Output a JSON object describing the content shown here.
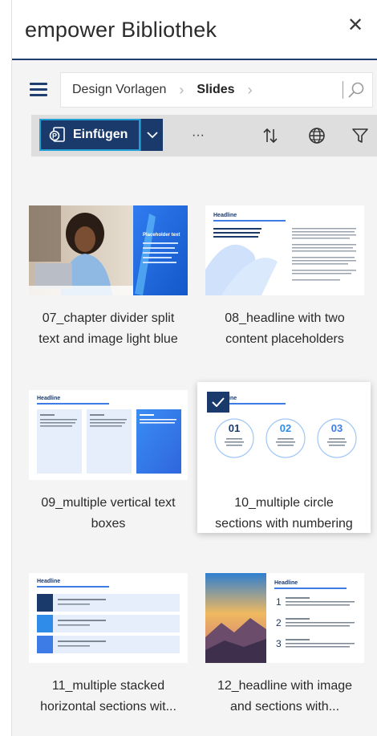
{
  "panel": {
    "title": "empower Bibliothek",
    "close_label": "✕"
  },
  "breadcrumb": {
    "items": [
      "Design Vorlagen",
      "Slides"
    ]
  },
  "toolbar": {
    "insert_label": "Einfügen",
    "more_label": "···"
  },
  "slides": [
    {
      "line1": "07_chapter divider split",
      "line2": "text and image light blue",
      "selected": false
    },
    {
      "line1": "08_headline with two",
      "line2": "content placeholders",
      "selected": false
    },
    {
      "line1": "09_multiple vertical text",
      "line2": "boxes",
      "selected": false
    },
    {
      "line1": "10_multiple circle",
      "line2": "sections with numbering",
      "selected": true
    },
    {
      "line1": "11_multiple stacked",
      "line2": "horizontal sections wit...",
      "selected": false
    },
    {
      "line1": "12_headline with image",
      "line2": "and sections with...",
      "selected": false
    }
  ],
  "thumb_text": {
    "placeholder": "Placeholder text",
    "headline": "Headline",
    "n1": "01",
    "n2": "02",
    "n3": "03",
    "s1": "1",
    "s2": "2",
    "s3": "3"
  },
  "colors": {
    "navy": "#1a3a6b",
    "accent": "#25a0d6",
    "blue": "#3d7be6"
  }
}
